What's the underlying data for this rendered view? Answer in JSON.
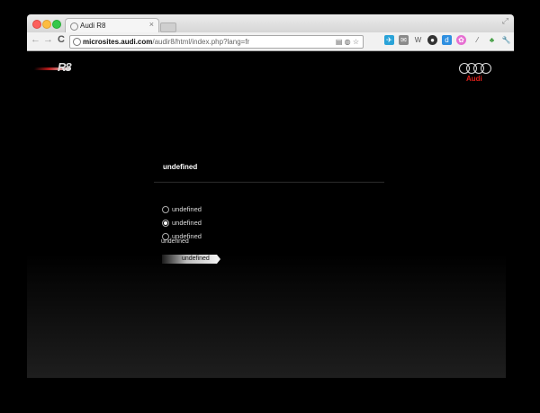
{
  "browser": {
    "tab_title": "Audi R8",
    "tab_close": "×",
    "url_host": "microsites.audi.com",
    "url_path": "/audir8/html/index.php?lang=fr",
    "nav_back": "←",
    "nav_forward": "→",
    "nav_reload": "C",
    "omnibox_icons": "▤ ◍ ☆",
    "extensions": [
      "twitter-icon",
      "mail-icon",
      "w-icon",
      "record-icon",
      "d-icon",
      "color-wheel-icon",
      "eyedropper-icon",
      "bug-icon",
      "wrench-icon"
    ],
    "ext_glyphs": [
      "✈",
      "✉",
      "W",
      "●",
      "d",
      "✿",
      "⁄",
      "♣",
      "🔧"
    ]
  },
  "site": {
    "r8_logo_text": "R8",
    "audi_wordmark": "Audi",
    "brand_red": "#e0201a"
  },
  "form": {
    "title": "undefined",
    "options": [
      {
        "label": "undefined",
        "selected": false
      },
      {
        "label": "undefined",
        "selected": true
      },
      {
        "label": "undefined",
        "selected": false
      }
    ],
    "field_label": "undefined",
    "submit_label": "undefined"
  }
}
